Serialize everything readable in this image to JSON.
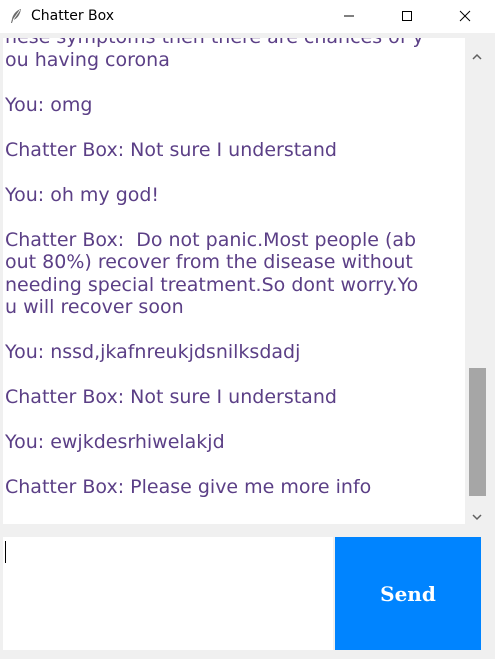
{
  "window": {
    "title": "Chatter Box",
    "icon": "feather-icon",
    "controls": {
      "minimize": "minimize-icon",
      "maximize": "maximize-icon",
      "close": "close-icon"
    }
  },
  "chat": {
    "lines": [
      "hese symptoms then there are chances of y",
      "ou having corona",
      "",
      "You: omg",
      "",
      "Chatter Box: Not sure I understand",
      "",
      "You: oh my god!",
      "",
      "Chatter Box:  Do not panic.Most people (ab",
      "out 80%) recover from the disease without",
      "needing special treatment.So dont worry.Yo",
      "u will recover soon",
      "",
      "You: nssd,jkafnreukjdsnilksdadj",
      "",
      "Chatter Box: Not sure I understand",
      "",
      "You: ewjkdesrhiwelakjd",
      "",
      "Chatter Box: Please give me more info"
    ],
    "text_color": "#5b3f86"
  },
  "scrollbar": {
    "up_icon": "chevron-up-icon",
    "down_icon": "chevron-down-icon",
    "position": 0.95
  },
  "input": {
    "value": ""
  },
  "send_button": {
    "label": "Send",
    "color": "#0084ff"
  }
}
